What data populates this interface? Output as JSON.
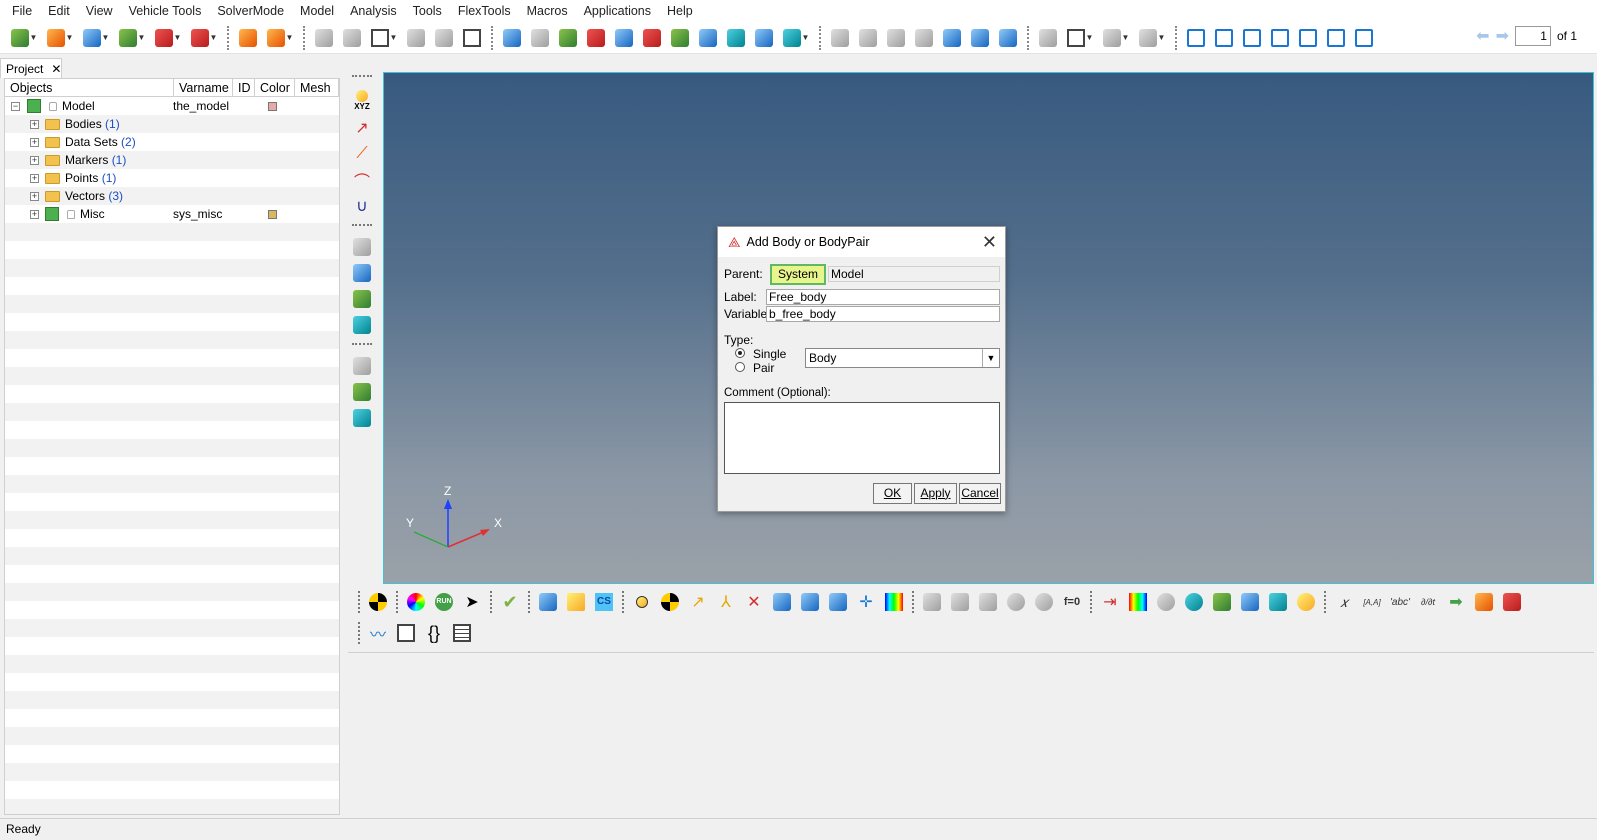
{
  "menu": [
    "File",
    "Edit",
    "View",
    "Vehicle Tools",
    "SolverMode",
    "Model",
    "Analysis",
    "Tools",
    "FlexTools",
    "Macros",
    "Applications",
    "Help"
  ],
  "pager": {
    "current": "1",
    "total_label": "of 1"
  },
  "project_tab": {
    "label": "Project"
  },
  "tree": {
    "headers": {
      "objects": "Objects",
      "varname": "Varname",
      "id": "ID",
      "color": "Color",
      "mesh": "Mesh"
    },
    "model": {
      "label": "Model",
      "varname": "the_model",
      "color": "#e8a9a9"
    },
    "folders": [
      {
        "name": "Bodies",
        "count": "(1)"
      },
      {
        "name": "Data Sets",
        "count": "(2)"
      },
      {
        "name": "Markers",
        "count": "(1)"
      },
      {
        "name": "Points",
        "count": "(1)"
      },
      {
        "name": "Vectors",
        "count": "(3)"
      }
    ],
    "misc": {
      "label": "Misc",
      "varname": "sys_misc",
      "color": "#d9b860"
    }
  },
  "axes": {
    "z": "Z",
    "y": "Y",
    "x": "X"
  },
  "dialog": {
    "title": "Add Body or BodyPair",
    "parent_label": "Parent:",
    "parent_button": "System",
    "parent_value": "Model",
    "label_label": "Label:",
    "label_value": "Free_body",
    "variable_label": "Variable:",
    "variable_value": "b_free_body",
    "type_label": "Type:",
    "single_label": "Single",
    "pair_label": "Pair",
    "type_select": "Body",
    "comment_label": "Comment (Optional):",
    "ok": "OK",
    "apply": "Apply",
    "cancel": "Cancel"
  },
  "vtool_text": {
    "xyz": "XYZ"
  },
  "btool_text": {
    "run": "RUN",
    "cs": "CS",
    "f0": "f=0",
    "fx": "𝑥",
    "aa": "[A,A]",
    "abc": "'abc'",
    "deriv": "∂/∂t"
  },
  "status": "Ready"
}
